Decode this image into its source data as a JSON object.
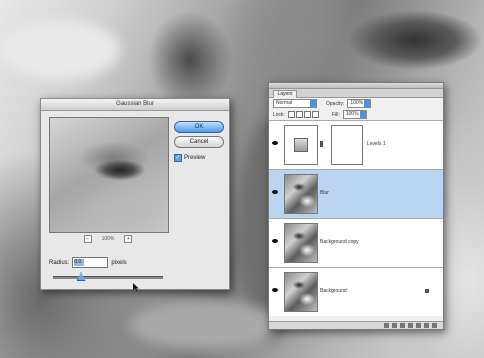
{
  "dialog": {
    "title": "Gaussian Blur",
    "ok_label": "OK",
    "cancel_label": "Cancel",
    "preview_label": "Preview",
    "preview_checked": true,
    "zoom_out": "−",
    "zoom_in": "+",
    "zoom_level": "100%",
    "radius_label": "Radius:",
    "radius_value": "0.0",
    "radius_unit": "pixels",
    "radius_slider_fraction": 0.25
  },
  "layers_panel": {
    "tab_label": "Layers",
    "blend_mode": "Normal",
    "opacity_label": "Opacity:",
    "opacity_value": "100%",
    "lock_label": "Lock:",
    "fill_label": "Fill:",
    "fill_value": "100%",
    "layers": [
      {
        "name": "Levels 1",
        "type": "adjustment",
        "visible": true,
        "selected": false
      },
      {
        "name": "Blur",
        "type": "image",
        "visible": true,
        "selected": true
      },
      {
        "name": "Background copy",
        "type": "image",
        "visible": true,
        "selected": false
      },
      {
        "name": "Background",
        "type": "image",
        "visible": true,
        "selected": false,
        "locked": true
      }
    ]
  },
  "colors": {
    "selection_blue": "#b9d5f2",
    "button_blue": "#4f9ae8"
  }
}
